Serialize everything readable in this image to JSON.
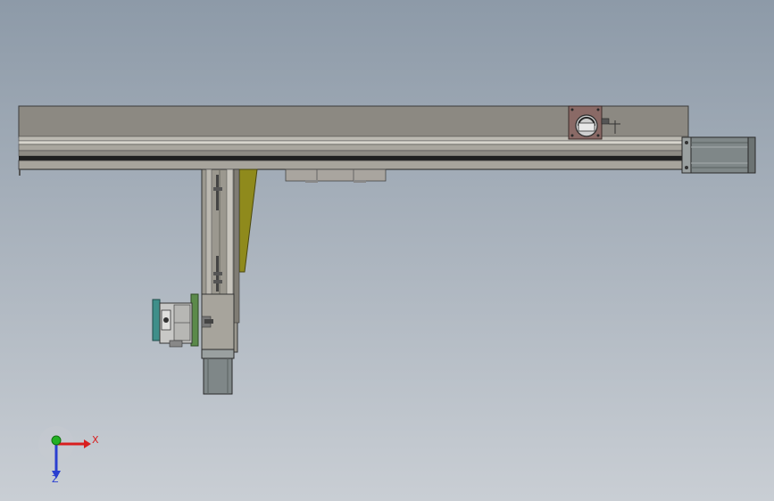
{
  "viewport": {
    "background_top": "#8d9aa8",
    "background_bottom": "#c9ced4"
  },
  "colors": {
    "frame_gray": "#8a8780",
    "rail_light": "#b9b6ae",
    "rail_dark": "#2b2b2b",
    "motor_gray": "#7f8788",
    "bracket_brown": "#8a6a66",
    "wedge_olive": "#8f8a1c",
    "plate_green": "#5b8a4a",
    "plate_teal": "#3f8f8a",
    "axis_x": "#d81e1e",
    "axis_y": "#23b023",
    "axis_z": "#2a3fd0"
  },
  "triad": {
    "x_label": "X",
    "z_label": "Z",
    "x_icon": "axis-x-arrow-icon",
    "y_icon": "axis-y-dot-icon",
    "z_icon": "axis-z-arrow-icon"
  }
}
